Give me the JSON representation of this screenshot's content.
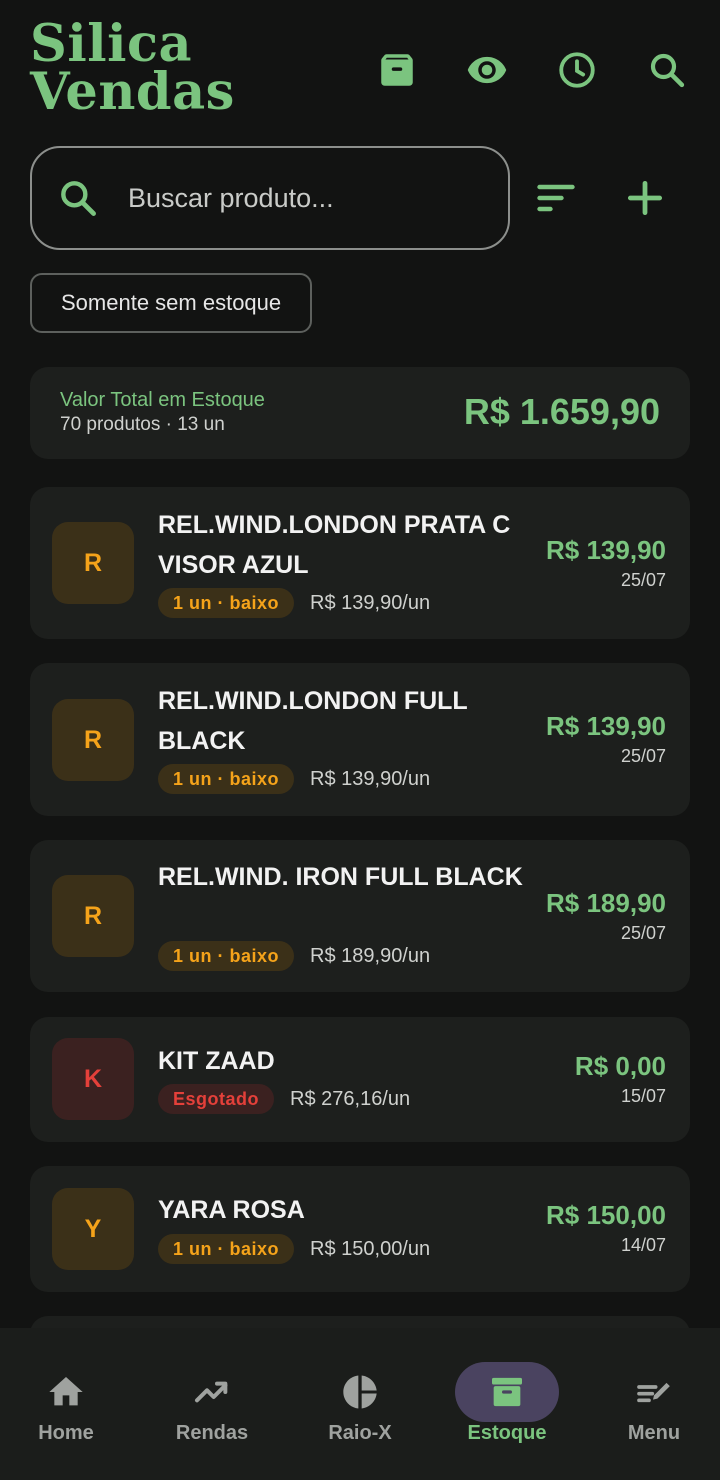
{
  "app": {
    "title_line1": "Silica",
    "title_line2": "Vendas"
  },
  "header_icons": [
    "archive-icon",
    "eye-icon",
    "clock-icon",
    "search-icon"
  ],
  "search": {
    "placeholder": "Buscar produto...",
    "value": ""
  },
  "filter_chip": "Somente sem estoque",
  "summary": {
    "label": "Valor Total em Estoque",
    "subtitle": "70 produtos · 13 un",
    "total": "R$ 1.659,90"
  },
  "products": [
    {
      "initial": "R",
      "name": "REL.WIND.LONDON PRATA C VISOR AZUL",
      "badge": "1 un · baixo",
      "status": "warn",
      "unit_price": "R$ 139,90/un",
      "price": "R$ 139,90",
      "date": "25/07"
    },
    {
      "initial": "R",
      "name": "REL.WIND.LONDON FULL BLACK",
      "badge": "1 un · baixo",
      "status": "warn",
      "unit_price": "R$ 139,90/un",
      "price": "R$ 139,90",
      "date": "25/07"
    },
    {
      "initial": "R",
      "name": "REL.WIND. IRON FULL BLACK",
      "badge": "1 un · baixo",
      "status": "warn",
      "unit_price": "R$ 189,90/un",
      "price": "R$ 189,90",
      "date": "25/07"
    },
    {
      "initial": "K",
      "name": "KIT ZAAD",
      "badge": "Esgotado",
      "status": "err",
      "unit_price": "R$ 276,16/un",
      "price": "R$ 0,00",
      "date": "15/07"
    },
    {
      "initial": "Y",
      "name": "YARA ROSA",
      "badge": "1 un · baixo",
      "status": "warn",
      "unit_price": "R$ 150,00/un",
      "price": "R$ 150,00",
      "date": "14/07"
    }
  ],
  "nav": [
    {
      "label": "Home",
      "icon": "home-icon",
      "active": false
    },
    {
      "label": "Rendas",
      "icon": "trending-up-icon",
      "active": false
    },
    {
      "label": "Raio-X",
      "icon": "pie-chart-icon",
      "active": false
    },
    {
      "label": "Estoque",
      "icon": "archive-icon",
      "active": true
    },
    {
      "label": "Menu",
      "icon": "edit-note-icon",
      "active": false
    }
  ],
  "colors": {
    "accent": "#7bc47f",
    "warning": "#f5a31a",
    "error": "#e4403a",
    "background": "#121312",
    "card": "#1d1f1d",
    "active_nav_pill": "#4a4360"
  }
}
